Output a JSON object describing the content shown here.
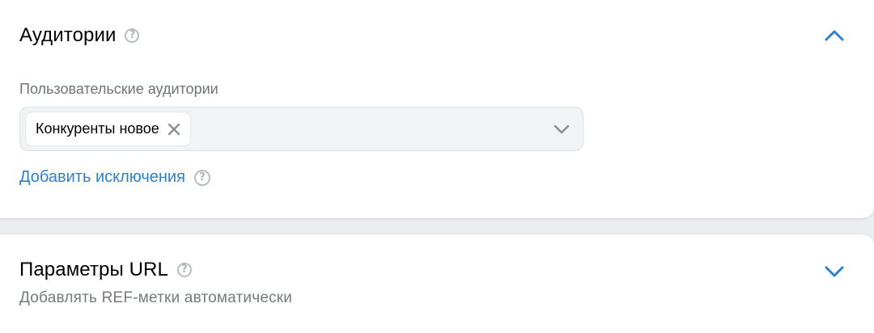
{
  "audiences": {
    "title": "Аудитории",
    "field_label": "Пользовательские аудитории",
    "selected_chip": "Конкуренты новое",
    "add_exclusions_link": "Добавить исключения",
    "expanded": true
  },
  "url_params": {
    "title": "Параметры URL",
    "subtitle": "Добавлять REF-метки автоматически",
    "expanded": false
  },
  "help_glyph": "?",
  "colors": {
    "accent": "#2f7fcf",
    "muted_text": "#6f7379",
    "field_bg": "#f2f3f5",
    "page_bg": "#ebedf0"
  },
  "icons": {
    "help": "question-circle-icon",
    "collapse": "chevron-up-icon",
    "expand": "chevron-down-icon",
    "remove": "close-icon"
  }
}
